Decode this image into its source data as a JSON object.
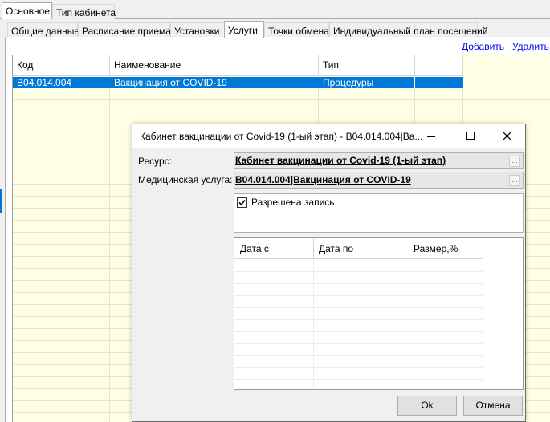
{
  "top_tabs": [
    "Основное",
    "Тип кабинета"
  ],
  "sub_tabs": [
    "Общие данные",
    "Расписание приема",
    "Установки",
    "Услуги",
    "Точки обмена",
    "Индивидуальный план посещений"
  ],
  "actions": {
    "add": "Добавить",
    "delete": "Удалить"
  },
  "grid": {
    "headers": [
      "Код",
      "Наименование",
      "Тип"
    ],
    "rows": [
      {
        "code": "B04.014.004",
        "name": "Вакцинация от COVID-19",
        "type": "Процедуры"
      }
    ]
  },
  "dialog": {
    "title": "Кабинет вакцинации от Covid-19 (1-ый этап) - B04.014.004|Ва...",
    "resource_label": "Ресурс:",
    "resource_value": "Кабинет вакцинации от Covid-19 (1-ый этап)",
    "service_label": "Медицинская услуга:",
    "service_value": "B04.014.004|Вакцинация от COVID-19",
    "allowed_label": "Разрешена запись",
    "allowed_checked": true,
    "periods_headers": [
      "Дата с",
      "Дата по",
      "Размер,%"
    ],
    "ok": "Ok",
    "cancel": "Отмена"
  },
  "colors": {
    "selection": "#0078d7",
    "grid_bg": "#ffffe6",
    "window": "#f0f0f0"
  }
}
